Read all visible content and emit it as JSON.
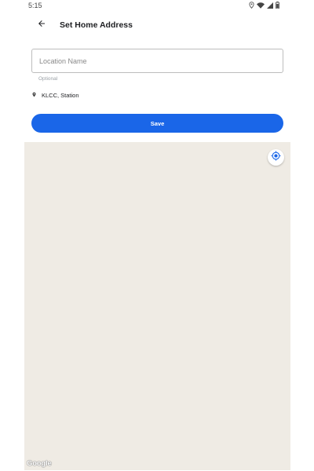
{
  "status_bar": {
    "time": "5:15",
    "icons": [
      "location-icon",
      "wifi-icon",
      "signal-icon",
      "battery-icon"
    ]
  },
  "app_bar": {
    "back_icon": "arrow-back-icon",
    "title": "Set Home Address"
  },
  "form": {
    "location_name": {
      "value": "",
      "placeholder": "Location Name",
      "helper": "Optional"
    },
    "address": {
      "icon": "location-pin-icon",
      "text": "KLCC, Station"
    },
    "save_label": "Save"
  },
  "map": {
    "my_location_icon": "my-location-icon",
    "attribution": "Google",
    "colors": {
      "background": "#efebe4",
      "control_icon": "#1a66e8"
    }
  },
  "colors": {
    "accent": "#1a66e8",
    "field_border": "#bdbdbd",
    "helper_text": "#9aa0a6"
  }
}
